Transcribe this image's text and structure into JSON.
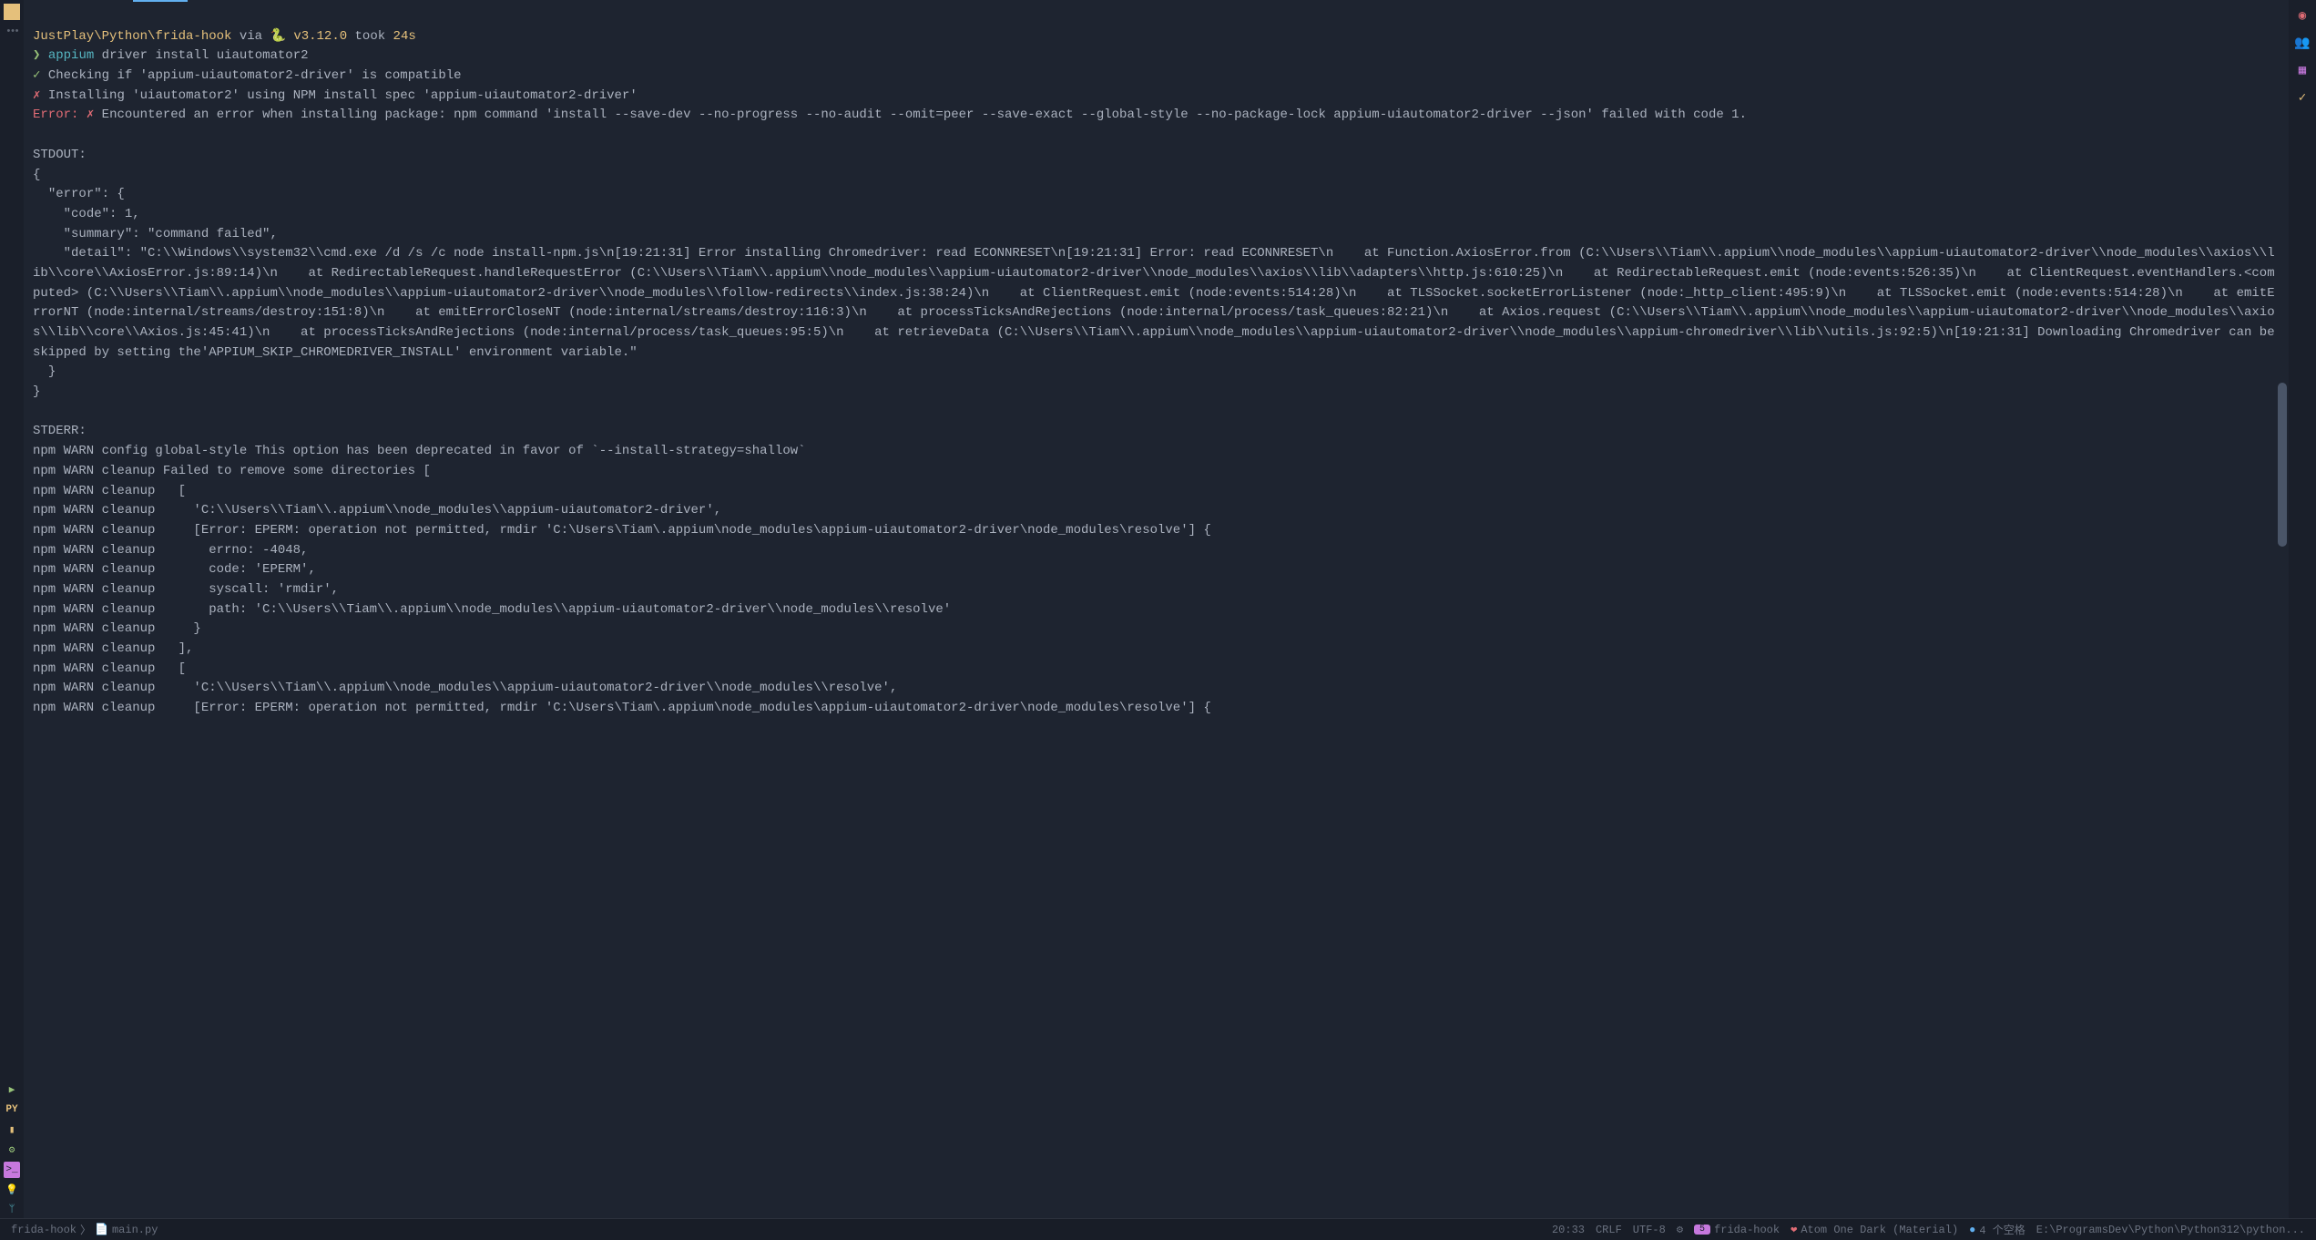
{
  "prompt": {
    "path": "JustPlay\\Python\\frida-hook",
    "via_label": "via",
    "version_icon": "🐍",
    "version": "v3.12.0",
    "took_label": "took",
    "took_time": "24s",
    "symbol": "❯"
  },
  "command": {
    "exe": "appium",
    "args": "driver install uiautomator2"
  },
  "output": {
    "check": "✓",
    "line_check": "Checking if 'appium-uiautomator2-driver' is compatible",
    "cross": "✗",
    "line_install": "Installing 'uiautomator2' using NPM install spec 'appium-uiautomator2-driver'",
    "error_label": "Error:",
    "line_error": "Encountered an error when installing package: npm command 'install --save-dev --no-progress --no-audit --omit=peer --save-exact --global-style --no-package-lock appium-uiautomator2-driver --json' failed with code 1.",
    "stdout_label": "STDOUT:",
    "stdout_body": "{\n  \"error\": {\n    \"code\": 1,\n    \"summary\": \"command failed\",\n    \"detail\": \"C:\\\\Windows\\\\system32\\\\cmd.exe /d /s /c node install-npm.js\\n[19:21:31] Error installing Chromedriver: read ECONNRESET\\n[19:21:31] Error: read ECONNRESET\\n    at Function.AxiosError.from (C:\\\\Users\\\\Tiam\\\\.appium\\\\node_modules\\\\appium-uiautomator2-driver\\\\node_modules\\\\axios\\\\lib\\\\core\\\\AxiosError.js:89:14)\\n    at RedirectableRequest.handleRequestError (C:\\\\Users\\\\Tiam\\\\.appium\\\\node_modules\\\\appium-uiautomator2-driver\\\\node_modules\\\\axios\\\\lib\\\\adapters\\\\http.js:610:25)\\n    at RedirectableRequest.emit (node:events:526:35)\\n    at ClientRequest.eventHandlers.<computed> (C:\\\\Users\\\\Tiam\\\\.appium\\\\node_modules\\\\appium-uiautomator2-driver\\\\node_modules\\\\follow-redirects\\\\index.js:38:24)\\n    at ClientRequest.emit (node:events:514:28)\\n    at TLSSocket.socketErrorListener (node:_http_client:495:9)\\n    at TLSSocket.emit (node:events:514:28)\\n    at emitErrorNT (node:internal/streams/destroy:151:8)\\n    at emitErrorCloseNT (node:internal/streams/destroy:116:3)\\n    at processTicksAndRejections (node:internal/process/task_queues:82:21)\\n    at Axios.request (C:\\\\Users\\\\Tiam\\\\.appium\\\\node_modules\\\\appium-uiautomator2-driver\\\\node_modules\\\\axios\\\\lib\\\\core\\\\Axios.js:45:41)\\n    at processTicksAndRejections (node:internal/process/task_queues:95:5)\\n    at retrieveData (C:\\\\Users\\\\Tiam\\\\.appium\\\\node_modules\\\\appium-uiautomator2-driver\\\\node_modules\\\\appium-chromedriver\\\\lib\\\\utils.js:92:5)\\n[19:21:31] Downloading Chromedriver can be skipped by setting the'APPIUM_SKIP_CHROMEDRIVER_INSTALL' environment variable.\"\n  }\n}",
    "stderr_label": "STDERR:",
    "stderr_lines": [
      "npm WARN config global-style This option has been deprecated in favor of `--install-strategy=shallow`",
      "npm WARN cleanup Failed to remove some directories [",
      "npm WARN cleanup   [",
      "npm WARN cleanup     'C:\\\\Users\\\\Tiam\\\\.appium\\\\node_modules\\\\appium-uiautomator2-driver',",
      "npm WARN cleanup     [Error: EPERM: operation not permitted, rmdir 'C:\\Users\\Tiam\\.appium\\node_modules\\appium-uiautomator2-driver\\node_modules\\resolve'] {",
      "npm WARN cleanup       errno: -4048,",
      "npm WARN cleanup       code: 'EPERM',",
      "npm WARN cleanup       syscall: 'rmdir',",
      "npm WARN cleanup       path: 'C:\\\\Users\\\\Tiam\\\\.appium\\\\node_modules\\\\appium-uiautomator2-driver\\\\node_modules\\\\resolve'",
      "npm WARN cleanup     }",
      "npm WARN cleanup   ],",
      "npm WARN cleanup   [",
      "npm WARN cleanup     'C:\\\\Users\\\\Tiam\\\\.appium\\\\node_modules\\\\appium-uiautomator2-driver\\\\node_modules\\\\resolve',",
      "npm WARN cleanup     [Error: EPERM: operation not permitted, rmdir 'C:\\Users\\Tiam\\.appium\\node_modules\\appium-uiautomator2-driver\\node_modules\\resolve'] {"
    ]
  },
  "status_bar": {
    "breadcrumb1": "frida-hook",
    "breadcrumb_sep": "〉",
    "breadcrumb_file_icon": "📄",
    "breadcrumb2": "main.py",
    "pos": "20:33",
    "eol": "CRLF",
    "encoding": "UTF-8",
    "indent_icon": "⚙",
    "env_badge": "5",
    "env_name": "frida-hook",
    "theme_icon": "❤",
    "theme": "Atom One Dark (Material)",
    "spaces_icon": "●",
    "spaces": "4 个空格",
    "path": "E:\\ProgramsDev\\Python\\Python312\\python..."
  },
  "right_icons": {
    "i1": "reddit-icon",
    "i2": "copilot-icon",
    "i3": "grid-icon",
    "i4": "checklist-icon"
  }
}
